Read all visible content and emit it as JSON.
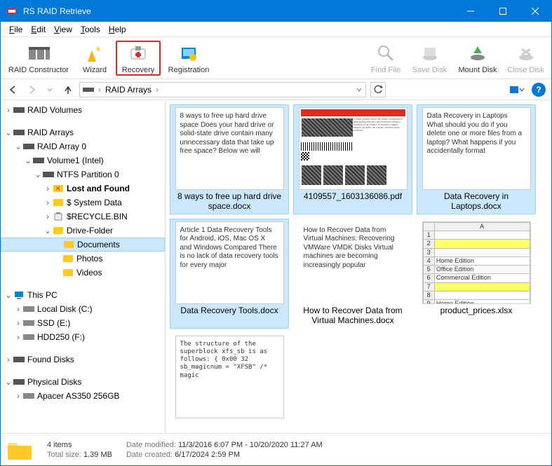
{
  "title": "RS RAID Retrieve",
  "menu": [
    "File",
    "Edit",
    "View",
    "Tools",
    "Help"
  ],
  "tools": [
    {
      "label": "RAID Constructor",
      "disabled": false
    },
    {
      "label": "Wizard",
      "disabled": false
    },
    {
      "label": "Recovery",
      "disabled": false,
      "highlight": true
    },
    {
      "label": "Registration",
      "disabled": false
    },
    {
      "label": "Find File",
      "disabled": true
    },
    {
      "label": "Save Disk",
      "disabled": true
    },
    {
      "label": "Mount Disk",
      "disabled": false
    },
    {
      "label": "Close Disk",
      "disabled": true
    }
  ],
  "breadcrumb": {
    "root": "RAID Arrays",
    "sep": "›"
  },
  "tree": {
    "raid_volumes": "RAID Volumes",
    "raid_arrays": "RAID Arrays",
    "raid_array_0": "RAID Array 0",
    "volume1": "Volume1 (Intel)",
    "ntfs_part": "NTFS Partition 0",
    "lost_found": "Lost and Found",
    "system_data": "$ System Data",
    "recycle": "$RECYCLE.BIN",
    "drive_folder": "Drive-Folder",
    "documents": "Documents",
    "photos": "Photos",
    "videos": "Videos",
    "this_pc": "This PC",
    "local_c": "Local Disk (C:)",
    "ssd_e": "SSD (E:)",
    "hdd_f": "HDD250 (F:)",
    "found_disks": "Found Disks",
    "physical_disks": "Physical Disks",
    "apacer": "Apacer AS350 256GB"
  },
  "files": [
    {
      "name": "8 ways to free up hard drive space.docx",
      "selected": true,
      "preview": "8 ways to free up hard drive space\nDoes your hard drive or solid-state drive contain many unnecessary data that take up free space? Below we will"
    },
    {
      "name": "4109557_1603136086.pdf",
      "selected": true,
      "preview": ""
    },
    {
      "name": "Data Recovery in Laptops.docx",
      "selected": true,
      "preview": "Data Recovery in Laptops\nWhat should you do if you delete one or more files from a laptop? What happens if you accidentally format"
    },
    {
      "name": "Data Recovery Tools.docx",
      "selected": true,
      "preview": "Article 1\nData Recovery Tools for Android, iOS, Mac OS X and Windows Compared\nThere is no lack of data recovery tools for every major"
    },
    {
      "name": "How to Recover Data from Virtual Machines.docx",
      "selected": false,
      "preview": "How to Recover Data from Virtual Machines: Recovering VMWare VMDK Disks\nVirtual machines are becoming increasingly popular"
    },
    {
      "name": "product_prices.xlsx",
      "selected": false,
      "preview": ""
    },
    {
      "name": "",
      "selected": false,
      "preview": "The structure of the superblock xfs_sb is as follows:\n{\n\n0x00     32\nsb_magicnum   = \"XFSB\"    /* magic"
    }
  ],
  "xlsx_rows": [
    "",
    "",
    "",
    "Home Edition",
    "Office Edition",
    "Commercial Edition",
    "",
    "",
    "Home Edition"
  ],
  "status": {
    "items_label": "4 items",
    "size_label": "Total size:",
    "size_value": "1.39 MB",
    "modified_label": "Date modified:",
    "modified_value": "11/3/2016 6:07 PM - 10/20/2020 11:27 AM",
    "created_label": "Date created:",
    "created_value": "6/17/2024 2:59 PM"
  }
}
